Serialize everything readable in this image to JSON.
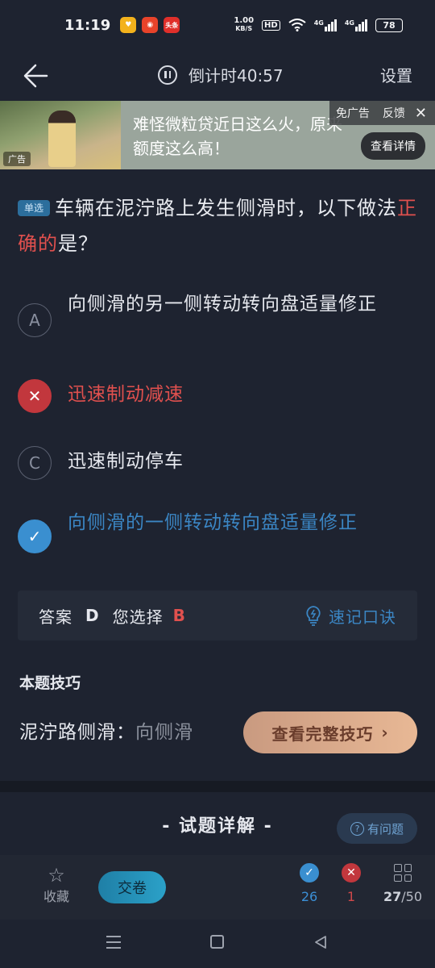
{
  "status_bar": {
    "time": "11:19",
    "app_icons": [
      {
        "name": "tmall-icon",
        "color": "#f3b21c",
        "glyph": "♥"
      },
      {
        "name": "weibo-icon",
        "color": "#e8432a",
        "glyph": "◉"
      },
      {
        "name": "toutiao-icon",
        "color": "#e02f2a",
        "glyph": "头条"
      }
    ],
    "net_speed_value": "1.00",
    "net_speed_unit": "KB/S",
    "hd": "HD",
    "signal1": "4G",
    "signal2": "4G",
    "battery": "78"
  },
  "header": {
    "timer": "倒计时40:57",
    "settings": "设置"
  },
  "ad": {
    "tag": "广告",
    "text": "难怪微粒贷近日这么火，原来额度这么高！",
    "no_ads": "免广告",
    "feedback": "反馈",
    "detail_button": "查看详情"
  },
  "question": {
    "type_tag": "单选",
    "text_before": "车辆在泥泞路上发生侧滑时，以下做法",
    "text_highlight": "正确的",
    "text_after": "是？"
  },
  "options": [
    {
      "marker": "A",
      "text": "向侧滑的另一侧转动转向盘适量修正",
      "state": "default"
    },
    {
      "marker": "✕",
      "text": "迅速制动减速",
      "state": "wrong"
    },
    {
      "marker": "C",
      "text": "迅速制动停车",
      "state": "default"
    },
    {
      "marker": "✓",
      "text": "向侧滑的一侧转动转向盘适量修正",
      "state": "correct"
    }
  ],
  "answer": {
    "label": "答案",
    "correct": "D",
    "chosen_label": "您选择",
    "chosen": "B",
    "memo": "速记口诀"
  },
  "tips": {
    "title": "本题技巧",
    "preview": "泥泞路侧滑：",
    "preview_faded": "向侧滑",
    "button": "查看完整技巧",
    "button_arrow": "›"
  },
  "explain": {
    "title": "- 试题详解 -",
    "ask_button": "有问题",
    "ask_icon": "?"
  },
  "bottom": {
    "favorite": "收藏",
    "submit": "交卷",
    "right_count": "26",
    "wrong_count": "1",
    "current": "27",
    "total": "/50"
  },
  "colors": {
    "background": "#1e2330",
    "correct": "#3a8fd0",
    "wrong": "#c2373d",
    "accent_orange": "#e8b895"
  }
}
